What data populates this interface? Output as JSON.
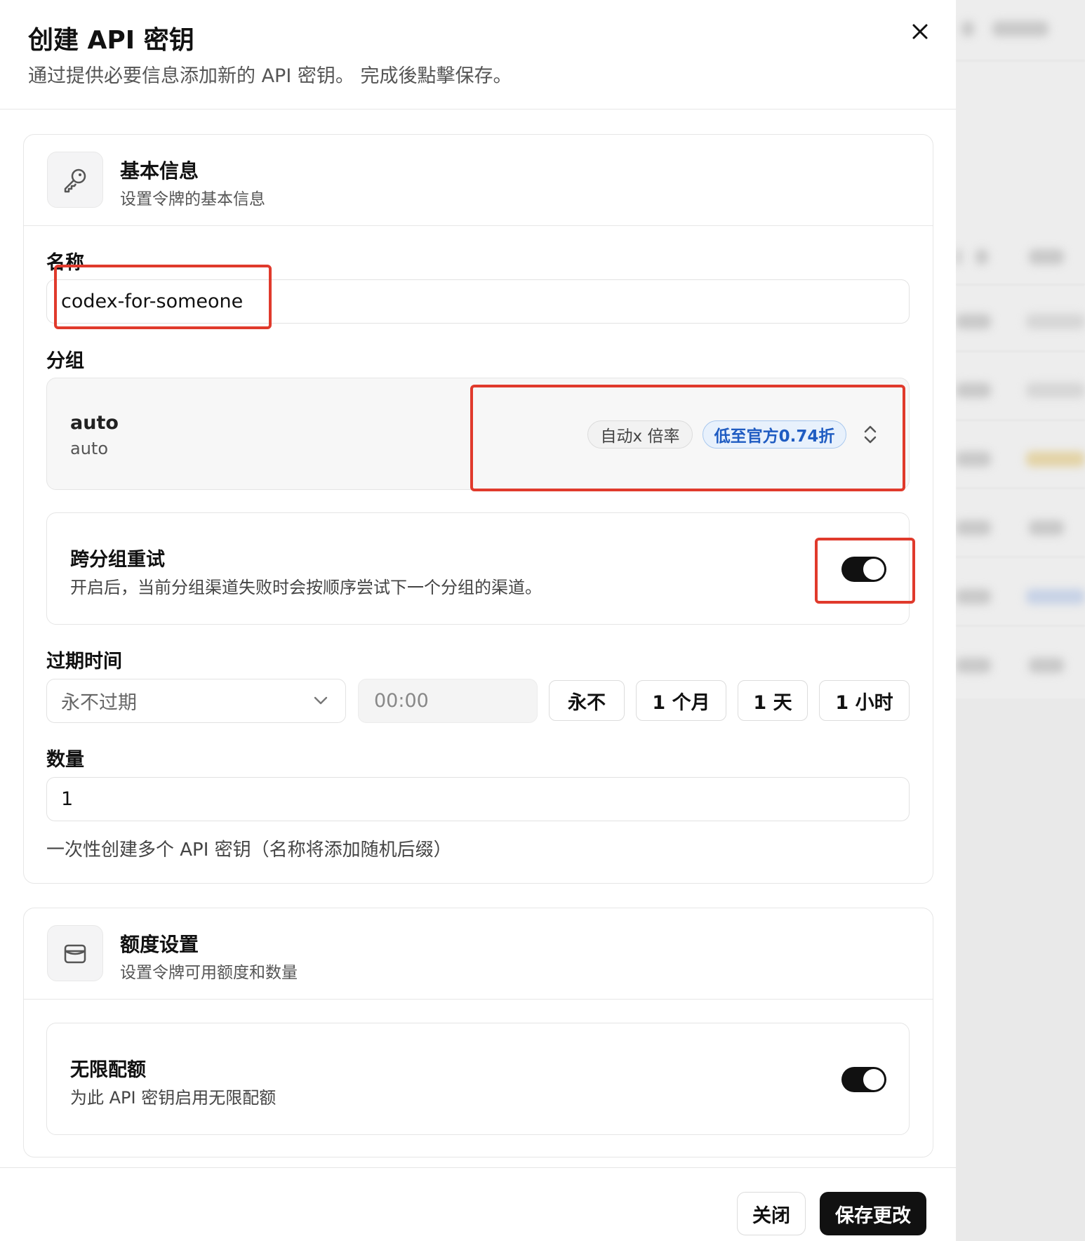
{
  "dialog": {
    "title": "创建 API 密钥",
    "subtitle": "通过提供必要信息添加新的 API 密钥。 完成後點擊保存。",
    "close_icon": "close-icon"
  },
  "basic_info": {
    "icon": "key-icon",
    "title": "基本信息",
    "description": "设置令牌的基本信息",
    "name_label": "名称",
    "name_value": "codex-for-someone",
    "group_label": "分组",
    "group_name": "auto",
    "group_subtext": "auto",
    "group_ratio_badge": "自动x 倍率",
    "group_discount_badge": "低至官方0.74折",
    "cross_group_retry_title": "跨分组重试",
    "cross_group_retry_desc": "开启后，当前分组渠道失败时会按顺序尝试下一个分组的渠道。",
    "cross_group_retry_enabled": true,
    "expiry_label": "过期时间",
    "expiry_select_value": "永不过期",
    "expiry_time_placeholder": "00:00",
    "expiry_quick_options": [
      "永不",
      "1 个月",
      "1 天",
      "1 小时"
    ],
    "count_label": "数量",
    "count_value": "1",
    "count_help": "一次性创建多个 API 密钥（名称将添加随机后缀）"
  },
  "quota_settings": {
    "icon": "wallet-icon",
    "title": "额度设置",
    "description": "设置令牌可用额度和数量",
    "unlimited_title": "无限配额",
    "unlimited_desc": "为此 API 密钥启用无限配额",
    "unlimited_enabled": true
  },
  "footer": {
    "close_label": "关闭",
    "save_label": "保存更改"
  },
  "colors": {
    "highlight": "#e03a2c",
    "badge_blue": "#1f5cc2",
    "toggle_on": "#111111"
  }
}
